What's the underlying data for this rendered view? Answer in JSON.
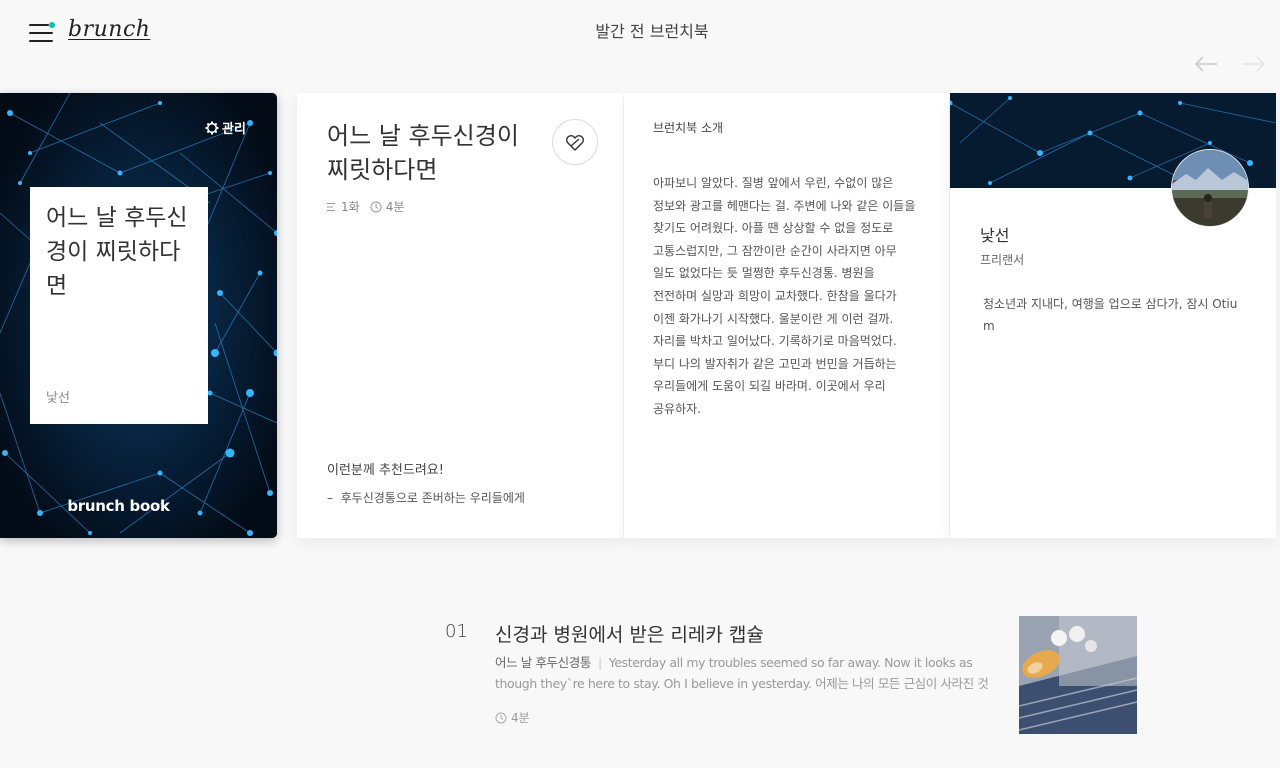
{
  "header": {
    "logo": "brunch",
    "title": "발간 전 브런치북",
    "accent_color": "#00c6be"
  },
  "cover": {
    "manage_label": "관리",
    "title": "어느 날 후두신경이 찌릿하다면",
    "author": "낯선",
    "book_label": "brunch book"
  },
  "book": {
    "title": "어느 날 후두신경이 찌릿하다면",
    "episodes": "1화",
    "read_time": "4분",
    "recommend_title": "이런분께 추천드려요!",
    "recommend_items": [
      "후두신경통으로 존버하는 우리들에게"
    ]
  },
  "intro": {
    "label": "브런치북 소개",
    "body": "아파보니 알았다. 질병 앞에서 우린, 수없이 많은 정보와 광고를 헤맨다는 걸. 주변에 나와 같은 이들을 찾기도 어려웠다. 아플 땐 상상할 수 없을 정도로 고통스럽지만, 그 잠깐이란 순간이 사라지면 아무 일도 없었다는 듯 멀쩡한 후두신경통. 병원을 전전하며 실망과 희망이 교차했다. 한참을 울다가 이젠 화가나기 시작했다. 울분이란 게 이런 걸까. 자리를 박차고 일어났다. 기록하기로 마음먹었다. 부디 나의 발자취가 같은 고민과 번민을 거듭하는 우리들에게 도움이 되길 바라며. 이곳에서 우리 공유하자."
  },
  "author": {
    "name": "낯선",
    "role": "프리랜서",
    "description": "청소년과 지내다, 여행을 업으로 삼다가, 잠시 Otium"
  },
  "articles": [
    {
      "number": "01",
      "title": "신경과 병원에서 받은 리레카 캡슐",
      "book_name": "어느 날 후두신경통",
      "excerpt": "Yesterday all my troubles seemed so far away. Now it looks as though they`re here to stay. Oh I believe in yesterday. 어제는 나의 모든 근심이 사라진 것 같았어.지금…",
      "read_time": "4분"
    }
  ]
}
